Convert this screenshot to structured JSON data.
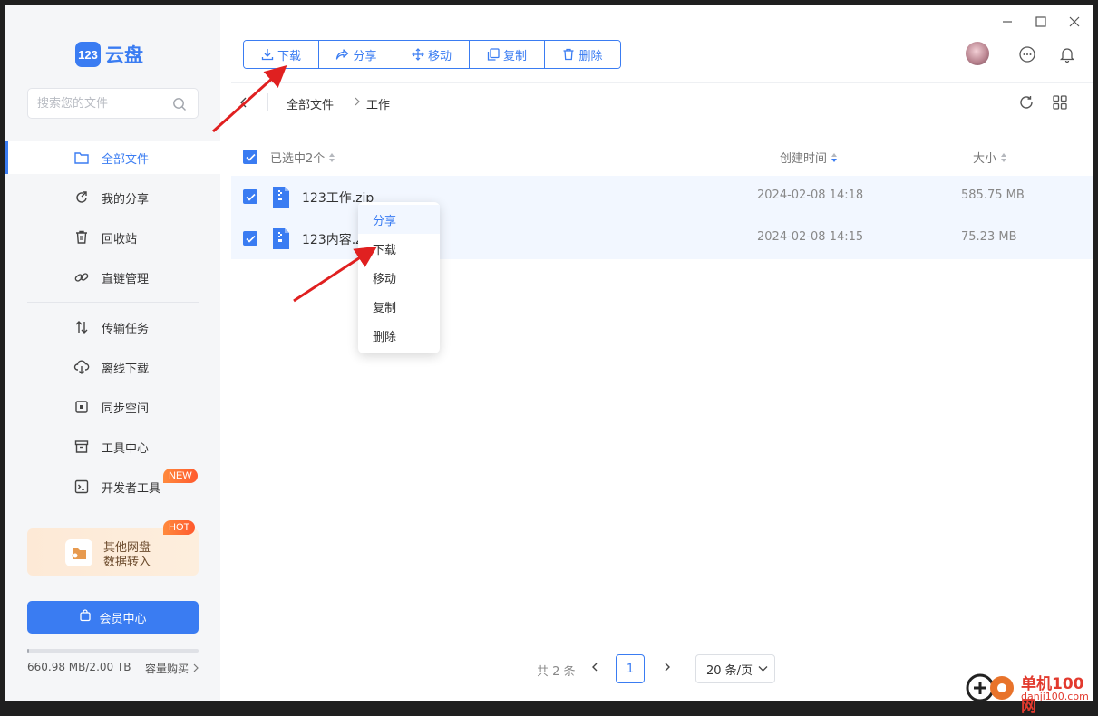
{
  "app": {
    "logo_badge": "123",
    "logo_text": "云盘"
  },
  "search": {
    "placeholder": "搜索您的文件"
  },
  "sidebar": {
    "items": [
      {
        "label": "全部文件",
        "icon": "folder-icon",
        "active": true
      },
      {
        "label": "我的分享",
        "icon": "share-icon"
      },
      {
        "label": "回收站",
        "icon": "trash-icon"
      },
      {
        "label": "直链管理",
        "icon": "link-icon"
      },
      {
        "label": "传输任务",
        "icon": "transfer-icon"
      },
      {
        "label": "离线下载",
        "icon": "cloud-download-icon"
      },
      {
        "label": "同步空间",
        "icon": "sync-icon"
      },
      {
        "label": "工具中心",
        "icon": "toolbox-icon"
      },
      {
        "label": "开发者工具",
        "icon": "terminal-icon",
        "badge": "NEW"
      }
    ],
    "promo": {
      "line1": "其他网盘",
      "line2": "数据转入",
      "badge": "HOT"
    },
    "vip_label": "会员中心",
    "quota": {
      "used_text": "660.98 MB/2.00 TB",
      "buy_label": "容量购买",
      "fraction": 0.0003
    }
  },
  "toolbar": {
    "buttons": [
      {
        "label": "下载",
        "icon": "download-icon"
      },
      {
        "label": "分享",
        "icon": "share-icon"
      },
      {
        "label": "移动",
        "icon": "move-icon"
      },
      {
        "label": "复制",
        "icon": "copy-icon"
      },
      {
        "label": "删除",
        "icon": "delete-icon"
      }
    ]
  },
  "breadcrumb": {
    "root": "全部文件",
    "current": "工作"
  },
  "table": {
    "selected_label": "已选中2个",
    "col_time": "创建时间",
    "col_size": "大小",
    "rows": [
      {
        "name": "123工作.zip",
        "time": "2024-02-08 14:18",
        "size": "585.75 MB",
        "checked": true
      },
      {
        "name": "123内容.z",
        "time": "2024-02-08 14:15",
        "size": "75.23 MB",
        "checked": true
      }
    ]
  },
  "context_menu": {
    "items": [
      "分享",
      "下载",
      "移动",
      "复制",
      "删除"
    ],
    "hovered": "分享"
  },
  "pager": {
    "total": "共 2 条",
    "page": "1",
    "page_size": "20 条/页"
  },
  "watermark": {
    "name": "单机100网",
    "url": "danji100.com"
  },
  "colors": {
    "accent": "#3a7cf2",
    "arrow": "#e02020"
  }
}
